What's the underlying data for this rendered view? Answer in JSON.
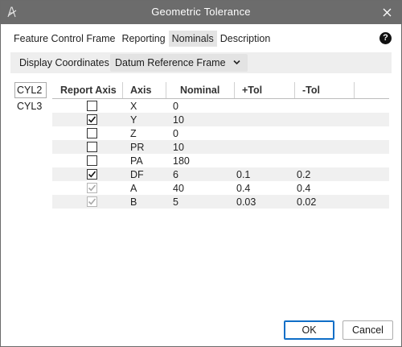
{
  "window": {
    "title": "Geometric Tolerance"
  },
  "tabs": [
    {
      "label": "Feature Control Frame",
      "active": false
    },
    {
      "label": "Reporting",
      "active": false
    },
    {
      "label": "Nominals",
      "active": true
    },
    {
      "label": "Description",
      "active": false
    }
  ],
  "coords": {
    "label": "Display Coordinates",
    "value": "Datum Reference Frame"
  },
  "features": [
    {
      "label": "CYL2",
      "selected": true
    },
    {
      "label": "CYL3",
      "selected": false
    }
  ],
  "table": {
    "headers": [
      "Report Axis",
      "Axis",
      "Nominal",
      "+Tol",
      "-Tol"
    ],
    "rows": [
      {
        "checked": false,
        "disabled": false,
        "axis": "X",
        "nominal": "0",
        "plus_tol": "",
        "minus_tol": ""
      },
      {
        "checked": true,
        "disabled": false,
        "axis": "Y",
        "nominal": "10",
        "plus_tol": "",
        "minus_tol": ""
      },
      {
        "checked": false,
        "disabled": false,
        "axis": "Z",
        "nominal": "0",
        "plus_tol": "",
        "minus_tol": ""
      },
      {
        "checked": false,
        "disabled": false,
        "axis": "PR",
        "nominal": "10",
        "plus_tol": "",
        "minus_tol": ""
      },
      {
        "checked": false,
        "disabled": false,
        "axis": "PA",
        "nominal": "180",
        "plus_tol": "",
        "minus_tol": ""
      },
      {
        "checked": true,
        "disabled": false,
        "axis": "DF",
        "nominal": "6",
        "plus_tol": "0.1",
        "minus_tol": "0.2"
      },
      {
        "checked": true,
        "disabled": true,
        "axis": "A",
        "nominal": "40",
        "plus_tol": "0.4",
        "minus_tol": "0.4"
      },
      {
        "checked": true,
        "disabled": true,
        "axis": "B",
        "nominal": "5",
        "plus_tol": "0.03",
        "minus_tol": "0.02"
      }
    ]
  },
  "buttons": {
    "ok": "OK",
    "cancel": "Cancel"
  },
  "icons": {
    "app": "caliper-app-icon",
    "close": "close-icon",
    "help": "help-icon",
    "dropdown": "chevron-down-icon",
    "check": "checkmark-icon"
  },
  "colors": {
    "titlebar": "#6c6c6c",
    "ok_border": "#0f6ec7",
    "row_alt": "#f0f0f0",
    "active_tab": "#e4e4e4"
  }
}
